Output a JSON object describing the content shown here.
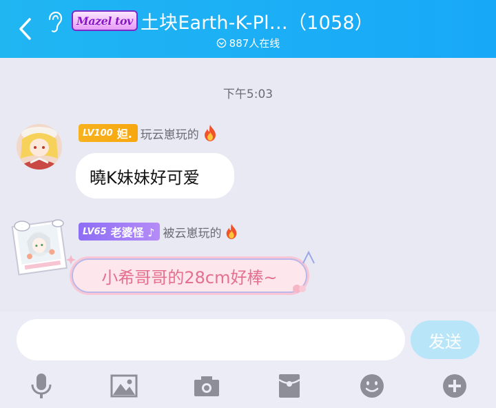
{
  "header": {
    "group_badge": "Mazel tov",
    "title": "土块Earth-K-Pl…（1058）",
    "online": "887人在线"
  },
  "timestamp": "下午5:03",
  "messages": [
    {
      "level": "LV100",
      "title_tag": "妲.",
      "nickname": "玩云崽玩的",
      "text": "曉K妹妹好可爱"
    },
    {
      "level": "LV65",
      "title_tag": "老婆怪 ♪",
      "nickname": "被云崽玩的",
      "text": "小希哥哥的28cm好棒~"
    }
  ],
  "input": {
    "placeholder": ""
  },
  "send_label": "发送",
  "colors": {
    "header": "#1bb0f5",
    "background": "#e9e9f3",
    "gold_badge": "#f7ad15",
    "purple_badge": "#9a78f6",
    "fancy_text": "#e46f8e",
    "send_disabled": "#b9e5f9",
    "tool_icon": "#8e8e99"
  },
  "toolbar": [
    {
      "icon": "microphone-icon"
    },
    {
      "icon": "image-icon"
    },
    {
      "icon": "camera-icon"
    },
    {
      "icon": "red-packet-icon"
    },
    {
      "icon": "emoji-icon"
    },
    {
      "icon": "plus-icon"
    }
  ]
}
